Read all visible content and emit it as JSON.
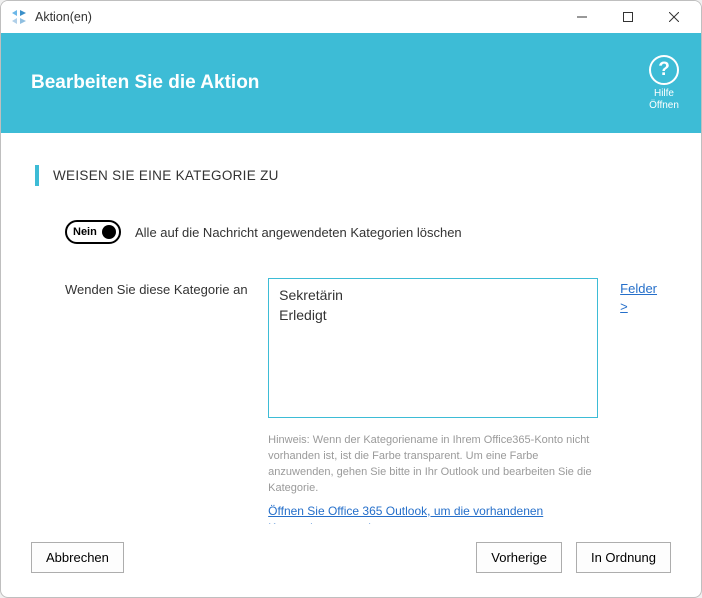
{
  "window": {
    "title": "Aktion(en)"
  },
  "header": {
    "title": "Bearbeiten Sie die Aktion",
    "help_line1": "Hilfe",
    "help_line2": "Öffnen"
  },
  "section": {
    "heading": "WEISEN SIE EINE KATEGORIE ZU"
  },
  "toggle": {
    "state_label": "Nein",
    "description": "Alle auf die Nachricht angewendeten Kategorien löschen"
  },
  "category_field": {
    "label": "Wenden Sie diese Kategorie an",
    "value": "Sekretärin\nErledigt",
    "fields_link": "Felder  >",
    "hint": "Hinweis: Wenn der Kategoriename in Ihrem Office365-Konto nicht vorhanden ist, ist die Farbe transparent. Um eine Farbe anzuwenden, gehen Sie bitte in Ihr Outlook und bearbeiten Sie die Kategorie.",
    "outlook_link": "Öffnen Sie Office 365 Outlook, um die vorhandenen Kategorien anzuzeigen >"
  },
  "footer": {
    "cancel": "Abbrechen",
    "previous": "Vorherige",
    "ok": "In Ordnung"
  }
}
